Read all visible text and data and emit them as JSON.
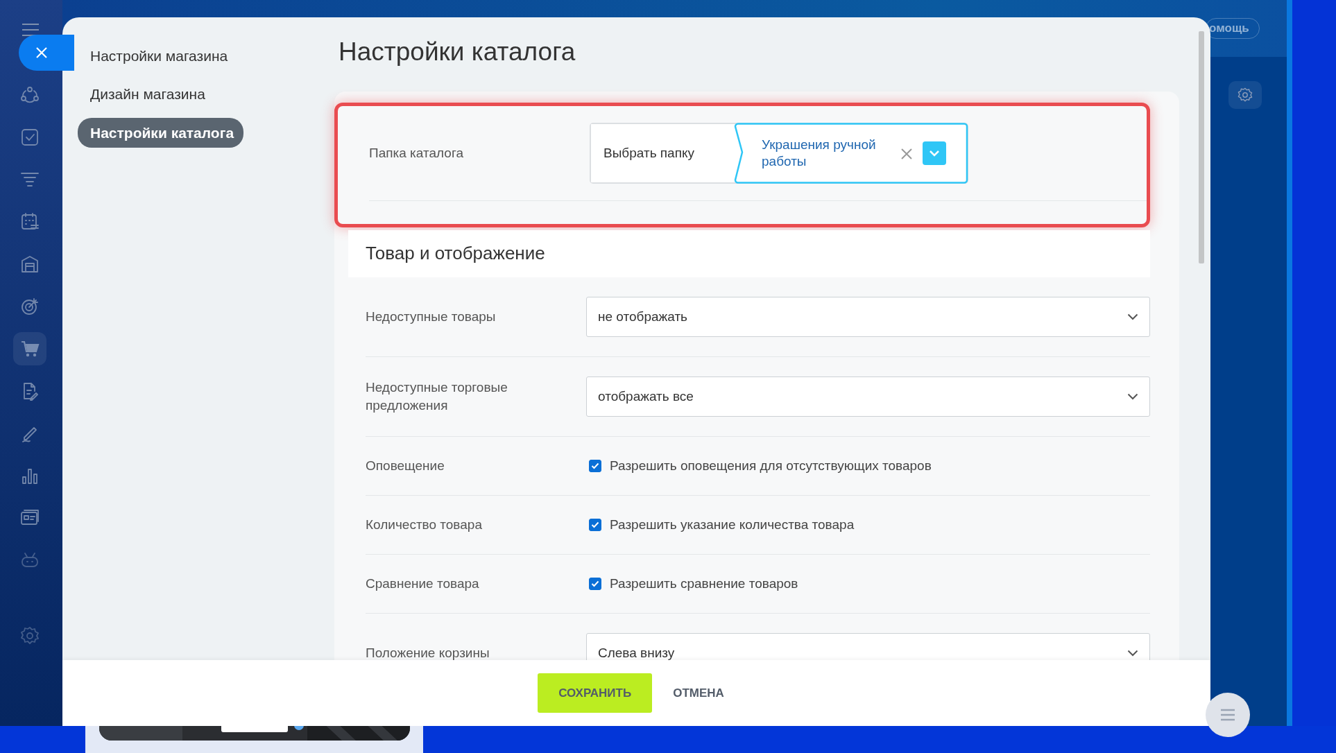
{
  "sidebar": {
    "items": [
      {
        "kind": "crm",
        "selected": false
      },
      {
        "kind": "tasks",
        "selected": false
      },
      {
        "kind": "funnel",
        "selected": false
      },
      {
        "kind": "calendar",
        "selected": false
      },
      {
        "kind": "store",
        "selected": false
      },
      {
        "kind": "target",
        "selected": false
      },
      {
        "kind": "cart",
        "selected": true
      },
      {
        "kind": "document",
        "selected": false
      },
      {
        "kind": "pen",
        "selected": false
      },
      {
        "kind": "chart",
        "selected": false
      },
      {
        "kind": "card",
        "selected": false
      },
      {
        "kind": "robot",
        "selected": false
      },
      {
        "kind": "settings",
        "selected": false
      }
    ]
  },
  "help_button": {
    "label": "омощь"
  },
  "modal": {
    "nav": [
      {
        "label": "Настройки магазина",
        "selected": false
      },
      {
        "label": "Дизайн магазина",
        "selected": false
      },
      {
        "label": "Настройки каталога",
        "selected": true
      }
    ],
    "title": "Настройки каталога",
    "folder": {
      "label": "Папка каталога",
      "button": "Выбрать папку",
      "value": "Украшения ручной работы"
    },
    "section_title": "Товар и отображение",
    "rows": [
      {
        "kind": "select",
        "label": "Недоступные товары",
        "value": "не отображать"
      },
      {
        "kind": "select",
        "label": "Недоступные торговые предложения",
        "value": "отображать все"
      },
      {
        "kind": "checkbox",
        "label": "Оповещение",
        "text": "Разрешить оповещения для отсутствующих товаров",
        "checked": true
      },
      {
        "kind": "checkbox",
        "label": "Количество товара",
        "text": "Разрешить указание количества товара",
        "checked": true
      },
      {
        "kind": "checkbox",
        "label": "Сравнение товара",
        "text": "Разрешить сравнение товаров",
        "checked": true
      },
      {
        "kind": "select",
        "label": "Положение корзины",
        "value": "Слева внизу"
      }
    ],
    "footer": {
      "save": "СОХРАНИТЬ",
      "cancel": "ОТМЕНА"
    }
  }
}
